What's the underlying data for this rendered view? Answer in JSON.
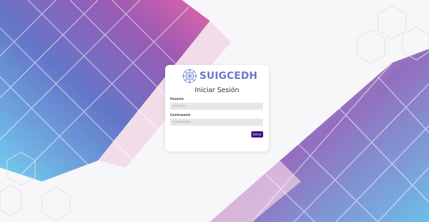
{
  "brand": {
    "name": "SUIGCEDH",
    "logo_icon": "globe-network-icon",
    "color": "#6a78c9"
  },
  "login": {
    "title": "Iniciar Sesión",
    "username_label": "Usuario",
    "username_placeholder": "Usuario",
    "password_label": "Contraseña",
    "password_placeholder": "Contraseña",
    "submit_label": "Entrar",
    "submit_color": "#3d0f89"
  }
}
